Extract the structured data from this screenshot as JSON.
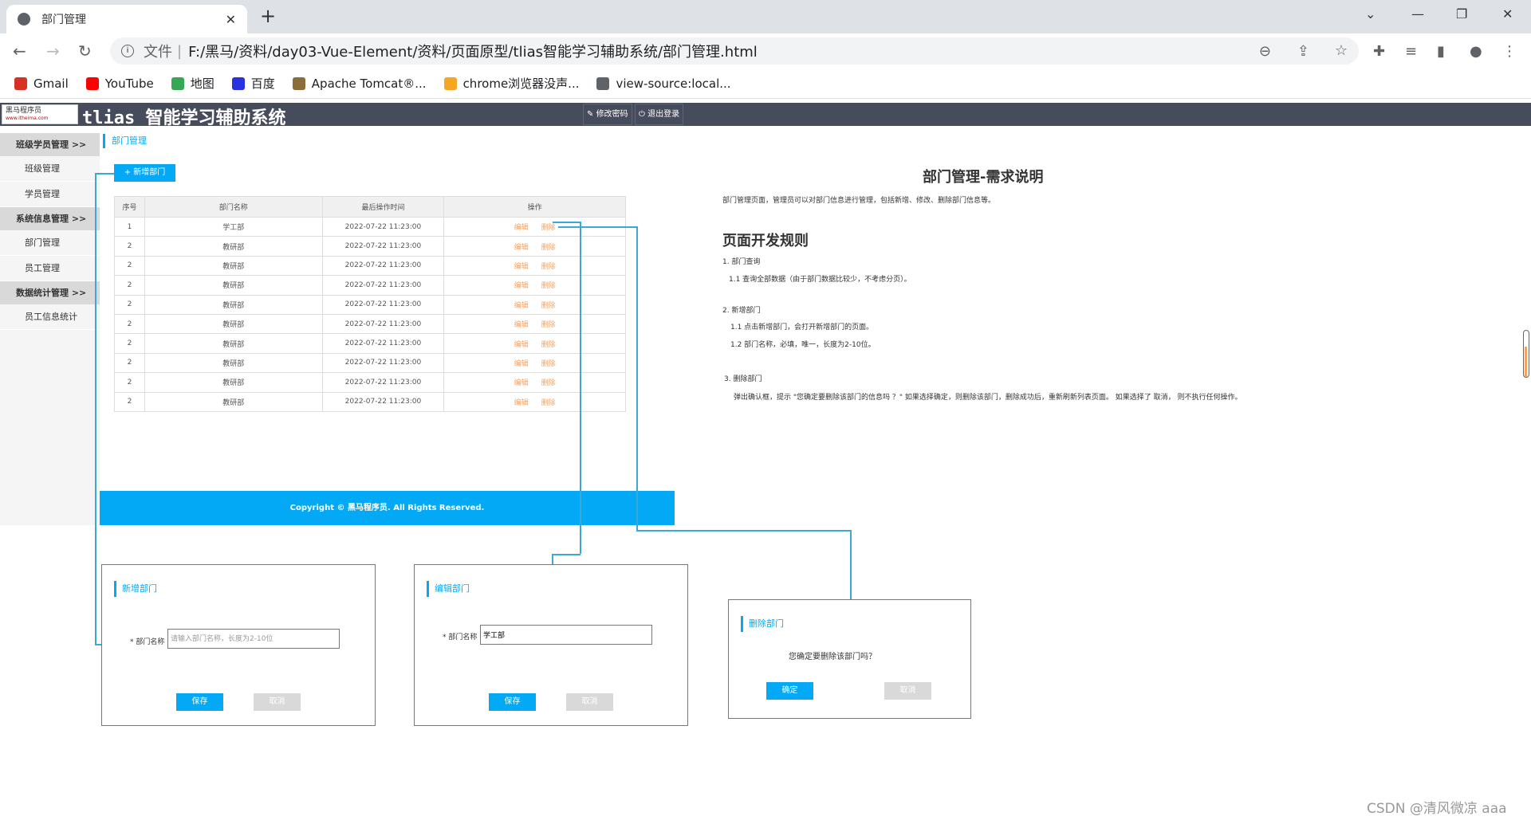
{
  "browser": {
    "tab_title": "部门管理",
    "url_prefix": "文件",
    "url": "F:/黑马/资料/day03-Vue-Element/资料/页面原型/tlias智能学习辅助系统/部门管理.html",
    "bookmarks": [
      {
        "label": "Gmail",
        "color": "#d93025"
      },
      {
        "label": "YouTube",
        "color": "#ff0000"
      },
      {
        "label": "地图",
        "color": "#34a853"
      },
      {
        "label": "百度",
        "color": "#2932e1"
      },
      {
        "label": "Apache Tomcat®...",
        "color": "#8a6d3b"
      },
      {
        "label": "chrome浏览器没声...",
        "color": "#f5a623"
      },
      {
        "label": "view-source:local...",
        "color": "#5f6368"
      }
    ]
  },
  "app": {
    "logo_text": "黑马程序员",
    "logo_sub": "www.itheima.com",
    "title": "tlias 智能学习辅助系统",
    "change_password": "修改密码",
    "logout": "退出登录"
  },
  "sidebar": {
    "groups": [
      {
        "label": "班级学员管理 >>",
        "items": [
          "班级管理",
          "学员管理"
        ]
      },
      {
        "label": "系统信息管理 >>",
        "items": [
          "部门管理",
          "员工管理"
        ]
      },
      {
        "label": "数据统计管理 >>",
        "items": [
          "员工信息统计"
        ]
      }
    ]
  },
  "breadcrumb": "部门管理",
  "add_button": "+ 新增部门",
  "table": {
    "headers": [
      "序号",
      "部门名称",
      "最后操作时间",
      "操作"
    ],
    "edit": "编辑",
    "delete": "删除",
    "rows": [
      [
        "1",
        "学工部",
        "2022-07-22 11:23:00"
      ],
      [
        "2",
        "教研部",
        "2022-07-22 11:23:00"
      ],
      [
        "2",
        "教研部",
        "2022-07-22 11:23:00"
      ],
      [
        "2",
        "教研部",
        "2022-07-22 11:23:00"
      ],
      [
        "2",
        "教研部",
        "2022-07-22 11:23:00"
      ],
      [
        "2",
        "教研部",
        "2022-07-22 11:23:00"
      ],
      [
        "2",
        "教研部",
        "2022-07-22 11:23:00"
      ],
      [
        "2",
        "教研部",
        "2022-07-22 11:23:00"
      ],
      [
        "2",
        "教研部",
        "2022-07-22 11:23:00"
      ],
      [
        "2",
        "教研部",
        "2022-07-22 11:23:00"
      ]
    ]
  },
  "footer": "Copyright © 黑马程序员. All Rights Reserved.",
  "doc": {
    "title": "部门管理-需求说明",
    "intro": "部门管理页面，管理员可以对部门信息进行管理，包括新增、修改、删除部门信息等。",
    "rules_title": "页面开发规则",
    "lines": [
      "1. 部门查询",
      "1.1  查询全部数据（由于部门数据比较少，不考虑分页）。",
      "2. 新增部门",
      "1.1 点击新增部门，会打开新增部门的页面。",
      "1.2 部门名称，必填，唯一，长度为2-10位。",
      "3. 删除部门",
      "弹出确认框，提示 \"您确定要删除该部门的信息吗 ？\" 如果选择确定，则删除该部门，删除成功后，重新刷新列表页面。 如果选择了 取消， 则不执行任何操作。"
    ]
  },
  "dialogs": {
    "add": {
      "title": "新增部门",
      "label": "* 部门名称",
      "placeholder": "请输入部门名称，长度为2-10位",
      "save": "保存",
      "cancel": "取消"
    },
    "edit": {
      "title": "编辑部门",
      "label": "* 部门名称",
      "value": "学工部",
      "save": "保存",
      "cancel": "取消"
    },
    "delete": {
      "title": "删除部门",
      "message": "您确定要删除该部门吗？",
      "confirm": "确定",
      "cancel": "取消"
    }
  },
  "watermark": "CSDN @清风微凉 aaa",
  "colors": {
    "accent": "#03a9f4",
    "header": "#474c5c",
    "link": "#f5a263"
  }
}
